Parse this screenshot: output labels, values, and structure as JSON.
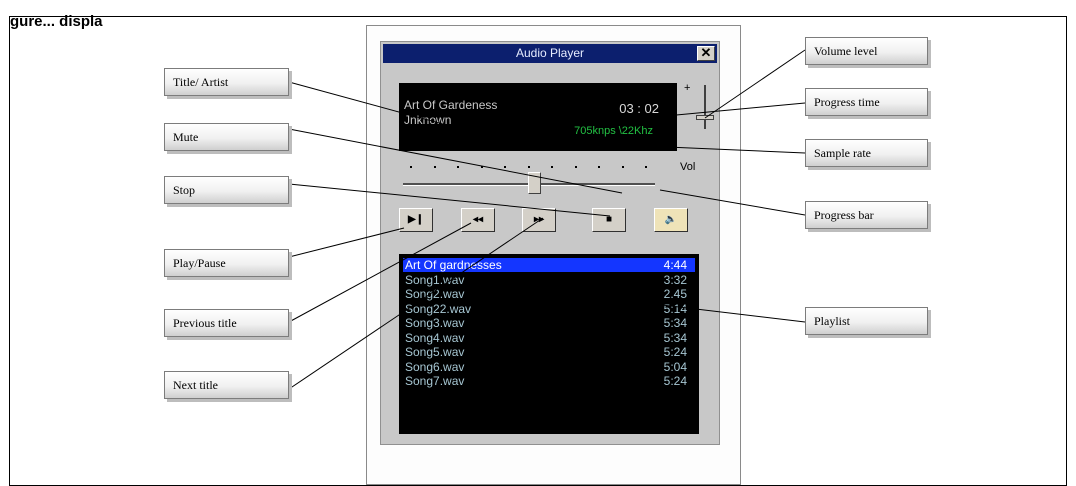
{
  "figure_heading": "gure... displa",
  "player": {
    "window_title": "Audio Player",
    "close_glyph": "✕",
    "display": {
      "title": "Art Of Gardeness",
      "artist": "Jnknown",
      "time": "03 : 02",
      "sample_rate": "705knps \\22Khz"
    },
    "volume": {
      "plus": "+",
      "label": "Vol",
      "level": 0.25
    },
    "progress": {
      "value": 0.52
    },
    "buttons": [
      {
        "name": "play-pause",
        "glyph": "▶❙"
      },
      {
        "name": "previous",
        "glyph": "◂◂"
      },
      {
        "name": "next",
        "glyph": "▸▸"
      },
      {
        "name": "stop",
        "glyph": "■"
      },
      {
        "name": "mute",
        "glyph": "🔈"
      }
    ],
    "playlist": [
      {
        "name": "Art Of gardnesses",
        "duration": "4:44",
        "selected": true
      },
      {
        "name": "Song1.wav",
        "duration": "3:32"
      },
      {
        "name": "Song2.wav",
        "duration": "2.45"
      },
      {
        "name": "Song22.wav",
        "duration": "5:14"
      },
      {
        "name": "Song3.wav",
        "duration": "5:34"
      },
      {
        "name": "Song4.wav",
        "duration": "5:34"
      },
      {
        "name": "Song5.wav",
        "duration": "5:24"
      },
      {
        "name": "Song6.wav",
        "duration": "5:04"
      },
      {
        "name": "Song7.wav",
        "duration": "5:24"
      }
    ]
  },
  "callouts": {
    "title_artist": "Title/ Artist",
    "mute": "Mute",
    "stop": "Stop",
    "play_pause": "Play/Pause",
    "previous_title": "Previous title",
    "next_title": "Next title",
    "volume_level": "Volume level",
    "progress_time": "Progress time",
    "sample_rate": "Sample rate",
    "progress_bar": "Progress bar",
    "playlist": "Playlist"
  },
  "colors": {
    "titlebar": "#0c1f6e",
    "selection": "#1436ff",
    "sample_rate_text": "#22c043",
    "playlist_text": "#a6c6d2"
  }
}
